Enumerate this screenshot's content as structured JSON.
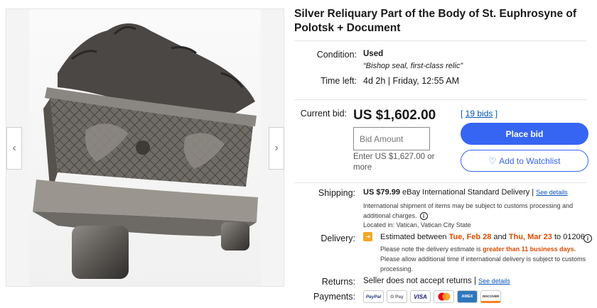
{
  "gallery": {
    "prev_glyph": "‹",
    "next_glyph": "›"
  },
  "listing": {
    "title": "Silver Reliquary Part of the Body of St. Euphrosyne of Polotsk + Document"
  },
  "condition": {
    "label": "Condition:",
    "value": "Used",
    "note": "“Bishop seal, first-class relic”"
  },
  "time_left": {
    "label": "Time left:",
    "value": "4d 2h | Friday, 12:55 AM"
  },
  "bid": {
    "label": "Current bid:",
    "price": "US $1,602.00",
    "bids_link": "19 bids",
    "bids_open": "[ ",
    "bids_close": " ]",
    "input_placeholder": "Bid Amount",
    "enter_text": "Enter US $1,627.00 or more",
    "place_bid": "Place bid",
    "watchlist": "Add to Watchlist",
    "watchlist_icon": "♡"
  },
  "shipping": {
    "label": "Shipping:",
    "cost": "US $79.99",
    "method": "eBay International Standard Delivery |",
    "details_link": "See details",
    "customs_note": "International shipment of items may be subject to customs processing and additional charges.",
    "location": "Located in: Vatican, Vatican City State"
  },
  "delivery": {
    "label": "Delivery:",
    "estimated_prefix": "Estimated between ",
    "date_start": "Tue, Feb 28",
    "and": " and ",
    "date_end": "Thu, Mar 23",
    "to_zip": " to 01206",
    "note1_prefix": "Please note the delivery estimate is ",
    "note1_emph": "greater than 11 business days.",
    "note2": "Please allow additional time if international delivery is subject to customs processing."
  },
  "returns": {
    "label": "Returns:",
    "value": "Seller does not accept returns |",
    "details_link": "See details"
  },
  "payments": {
    "label": "Payments:",
    "methods": [
      "PayPal",
      "G Pay",
      "VISA",
      "",
      "AMEX",
      "DISCOVER"
    ]
  },
  "colors": {
    "primary": "#3665f3",
    "link": "#0654ba",
    "orange": "#dd4d00"
  }
}
